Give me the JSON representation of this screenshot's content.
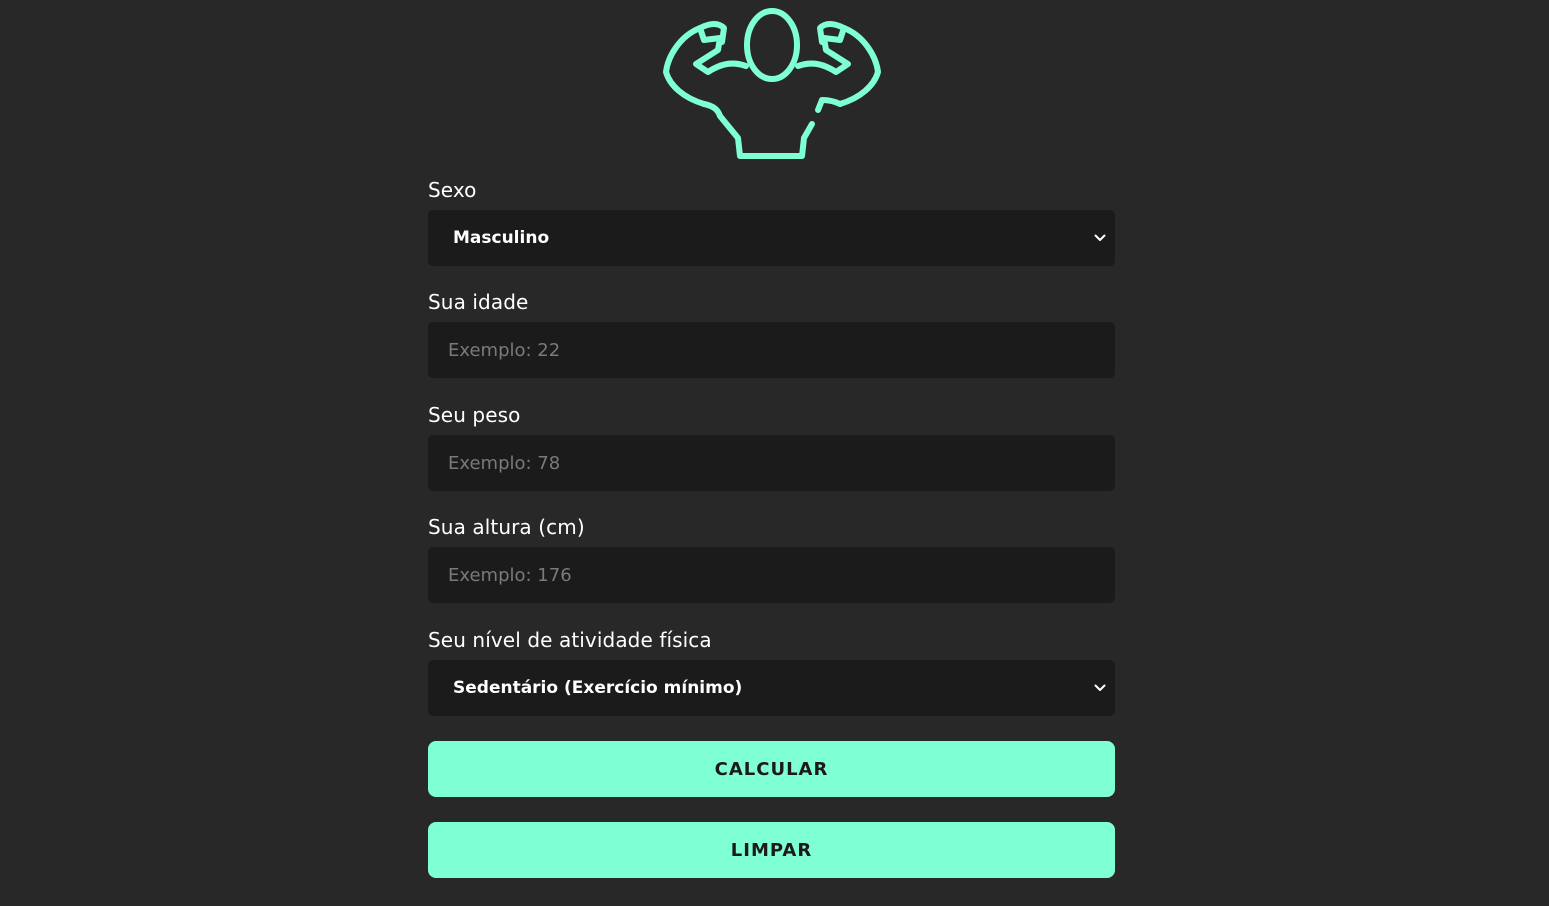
{
  "logo": {
    "icon": "flexing-man-icon",
    "color": "#7fffd4"
  },
  "form": {
    "sex": {
      "label": "Sexo",
      "value": "Masculino"
    },
    "age": {
      "label": "Sua idade",
      "placeholder": "Exemplo: 22"
    },
    "weight": {
      "label": "Seu peso",
      "placeholder": "Exemplo: 78"
    },
    "height": {
      "label": "Sua altura (cm)",
      "placeholder": "Exemplo: 176"
    },
    "activity": {
      "label": "Seu nível de atividade física",
      "value": "Sedentário (Exercício mínimo)"
    }
  },
  "buttons": {
    "calculate": "CALCULAR",
    "clear": "LIMPAR"
  },
  "colors": {
    "background": "#282828",
    "field": "#1b1b1b",
    "accent": "#7fffd4"
  }
}
